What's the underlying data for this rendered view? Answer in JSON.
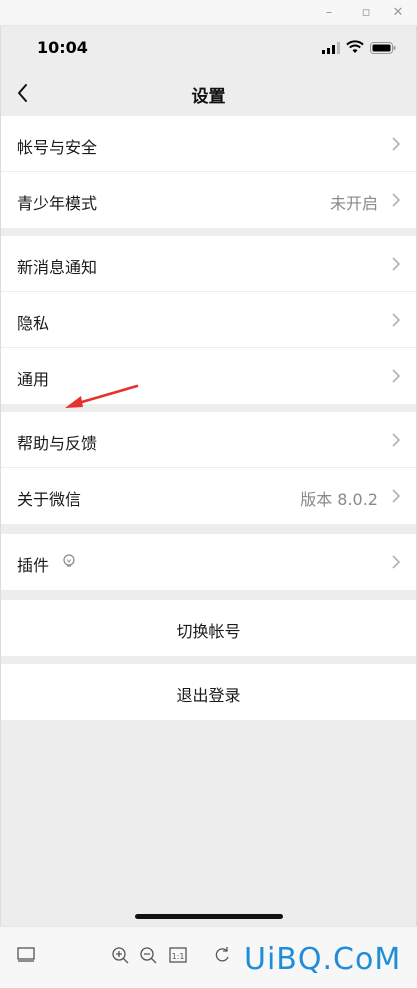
{
  "status_bar": {
    "time": "10:04"
  },
  "nav": {
    "title": "设置"
  },
  "groups": [
    {
      "rows": [
        {
          "label": "帐号与安全"
        },
        {
          "label": "青少年模式",
          "value": "未开启"
        }
      ]
    },
    {
      "rows": [
        {
          "label": "新消息通知"
        },
        {
          "label": "隐私"
        },
        {
          "label": "通用"
        }
      ]
    },
    {
      "rows": [
        {
          "label": "帮助与反馈"
        },
        {
          "label": "关于微信",
          "value": "版本 8.0.2"
        }
      ]
    },
    {
      "rows": [
        {
          "label": "插件"
        }
      ]
    }
  ],
  "actions": {
    "switch_account": "切换帐号",
    "logout": "退出登录"
  },
  "colors": {
    "annotation_arrow": "#e5322e",
    "page_bg": "#ededed",
    "watermark": "#1e8ed8"
  },
  "watermark": "UiBQ.CoM"
}
